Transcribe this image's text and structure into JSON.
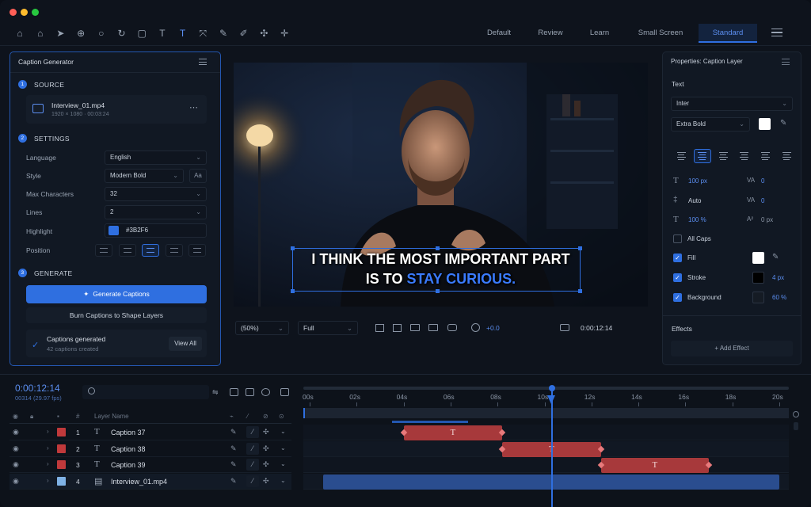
{
  "window": {
    "traffic": [
      "#ff5f57",
      "#febc2e",
      "#28c840"
    ]
  },
  "workspaces": [
    "Default",
    "Review",
    "Learn",
    "Small Screen",
    "Standard"
  ],
  "active_workspace": "Standard",
  "toolbar_icons": [
    "home-icon",
    "home-outline-icon",
    "selection-icon",
    "zoom-tool-icon",
    "search-icon",
    "rotate-icon",
    "rectangle-icon",
    "type-icon",
    "vertical-type-icon",
    "pin-icon",
    "pen-icon",
    "brush-icon",
    "stamp-icon",
    "puppet-icon"
  ],
  "caption_panel": {
    "title": "Caption Generator",
    "source": {
      "header": "SOURCE",
      "num": "1",
      "file": "Interview_01.mp4",
      "meta": "1920 × 1080  ·  00:03:24"
    },
    "settings": {
      "header": "SETTINGS",
      "num": "2",
      "language_label": "Language",
      "language": "English",
      "style_label": "Style",
      "style": "Modern Bold",
      "style_btn": "Aa",
      "maxchars_label": "Max Characters",
      "maxchars": "32",
      "lines_label": "Lines",
      "lines": "2",
      "highlight_label": "Highlight",
      "highlight": "#3B2F6",
      "highlight_color": "#2f6fe0",
      "position_label": "Position"
    },
    "generate": {
      "header": "GENERATE",
      "num": "3",
      "primary": "Generate Captions",
      "secondary": "Burn Captions to Shape Layers",
      "status_title": "Captions generated",
      "status_sub": "42 captions created",
      "view_all": "View All"
    }
  },
  "viewer": {
    "caption_line1": "I THINK THE MOST IMPORTANT PART",
    "caption_line2_a": "IS TO ",
    "caption_line2_b": "STAY CURIOUS.",
    "highlight_color": "#3a7bff",
    "zoom": "(50%)",
    "res": "Full",
    "exposure": "+0.0",
    "timecode": "0:00:12:14"
  },
  "properties": {
    "title": "Properties: Caption Layer",
    "text_header": "Text",
    "font": "Inter",
    "weight": "Extra Bold",
    "size": "100 px",
    "tracking": "0",
    "leading": "Auto",
    "kerning": "0",
    "scale": "100 %",
    "baseline": "0 px",
    "all_caps": "All Caps",
    "fill": "Fill",
    "stroke": "Stroke",
    "stroke_val": "4 px",
    "background": "Background",
    "bg_val": "60 %",
    "effects": "Effects",
    "add_effect": "+ Add Effect"
  },
  "timeline": {
    "timecode": "0:00:12:14",
    "fps": "00314 (29.97 fps)",
    "col_num": "#",
    "col_name": "Layer Name",
    "ruler": [
      "00s",
      "02s",
      "04s",
      "06s",
      "08s",
      "10s",
      "12s",
      "14s",
      "16s",
      "18s",
      "20s"
    ],
    "layers": [
      {
        "num": "1",
        "name": "Caption 37",
        "color": "#c0393b",
        "type": "T"
      },
      {
        "num": "2",
        "name": "Caption 38",
        "color": "#c0393b",
        "type": "T"
      },
      {
        "num": "3",
        "name": "Caption 39",
        "color": "#c0393b",
        "type": "T"
      },
      {
        "num": "4",
        "name": "Interview_01.mp4",
        "color": "#7fb2e5",
        "type": "file"
      }
    ],
    "clips": [
      {
        "start": 4.0,
        "end": 8.2,
        "label": "T"
      },
      {
        "start": 8.2,
        "end": 12.4,
        "label": "T"
      },
      {
        "start": 12.4,
        "end": 17.0,
        "label": "T"
      },
      {
        "start": 0.9,
        "end": 20.0,
        "label": ""
      }
    ],
    "playhead": 10.3,
    "duration": 20.0
  }
}
